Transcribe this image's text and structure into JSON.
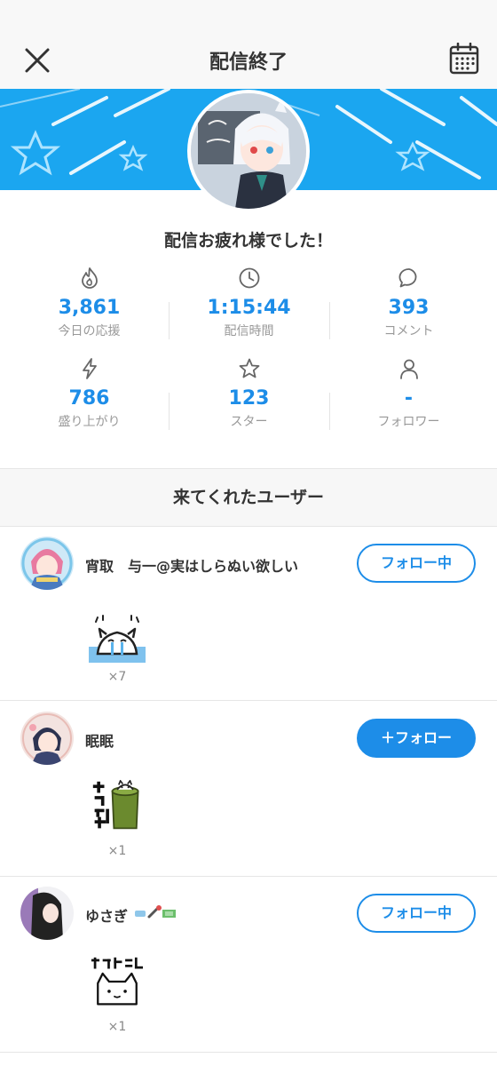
{
  "header": {
    "title": "配信終了"
  },
  "summary": {
    "message": "配信お疲れ様でした！"
  },
  "stats": [
    {
      "icon": "flame-icon",
      "value": "3,861",
      "label": "今日の応援"
    },
    {
      "icon": "clock-icon",
      "value": "1:15:44",
      "label": "配信時間"
    },
    {
      "icon": "comment-icon",
      "value": "393",
      "label": "コメント"
    },
    {
      "icon": "lightning-icon",
      "value": "786",
      "label": "盛り上がり"
    },
    {
      "icon": "star-icon",
      "value": "123",
      "label": "スター"
    },
    {
      "icon": "person-icon",
      "value": "-",
      "label": "フォロワー"
    }
  ],
  "visitors": {
    "title": "来てくれたユーザー",
    "users": [
      {
        "name": "宵取　与一@実はしらぬい欲しい",
        "button": "フォロー中",
        "following": true,
        "sticker": "crying-cat-sticker",
        "count": "×7"
      },
      {
        "name": "眠眠",
        "button": "＋フォロー",
        "following": false,
        "sticker": "otsukaresama-cat-sticker",
        "count": "×1"
      },
      {
        "name": "ゆさぎ",
        "button": "フォロー中",
        "following": true,
        "sticker": "wakaran-cat-sticker",
        "count": "×1"
      }
    ]
  },
  "colors": {
    "accent": "#1d8de8",
    "banner": "#1ba6f0"
  }
}
